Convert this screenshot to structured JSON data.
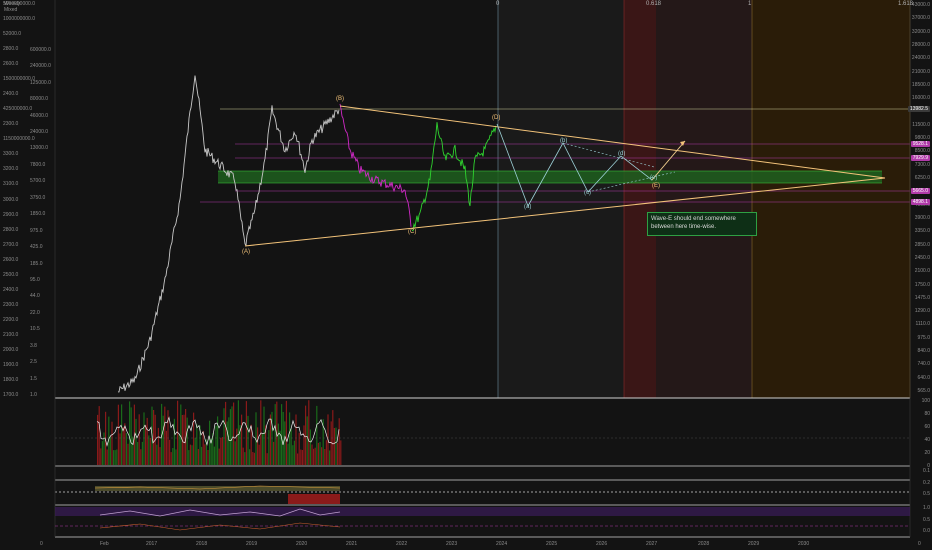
{
  "chart_data": {
    "type": "line",
    "title": "",
    "xlabel": "",
    "ylabel": "",
    "x_ticks": [
      "Feb",
      "2017",
      "2018",
      "2019",
      "2020",
      "2021",
      "2022",
      "2023",
      "2024",
      "2025",
      "2026",
      "2027",
      "2028",
      "2029",
      "2030"
    ],
    "left_axis_ticks": [
      "5000000000.0",
      "1000000000.0",
      "52000.0",
      "2800.0",
      "2600.0",
      "1500000000.0",
      "2400.0",
      "425000000.0",
      "2300.0",
      "1150000000.0",
      "3300.0",
      "3200.0",
      "3100.0",
      "3000.0",
      "2900.0",
      "2800.0",
      "2700.0",
      "2600.0",
      "2500.0",
      "2400.0",
      "2300.0",
      "2200.0",
      "2100.0",
      "2000.0",
      "1900.0",
      "1800.0",
      "1700.0"
    ],
    "left_axis_ticks_short": [
      "Weekly",
      "Mixed",
      "600000.0",
      "240000.0",
      "125000.0",
      "80000.0",
      "46000.0",
      "24000.0",
      "13000.0",
      "7800.0",
      "5700.0",
      "3750.0",
      "1850.0",
      "975.0",
      "425.0",
      "185.0",
      "95.0",
      "44.0",
      "22.0",
      "10.5",
      "3.8",
      "2.5",
      "1.5",
      "1.0"
    ],
    "right_axis_ticks": [
      "43000.0",
      "37000.0",
      "32000.0",
      "28000.0",
      "24000.0",
      "21000.0",
      "18500.0",
      "16000.0",
      "13500.0",
      "11500.0",
      "9800.0",
      "8500.0",
      "7300.0",
      "6250.0",
      "5250.0",
      "4500.0",
      "3900.0",
      "3350.0",
      "2850.0",
      "2450.0",
      "2100.0",
      "1750.0",
      "1475.0",
      "1290.0",
      "1110.0",
      "975.0",
      "840.0",
      "740.0",
      "640.0",
      "565.0"
    ],
    "price_tags": [
      {
        "value": "13982.5",
        "color": "#3a3a3a"
      },
      {
        "value": "9528.1",
        "color": "#b03aa8"
      },
      {
        "value": "7929.9",
        "color": "#b03aa8"
      },
      {
        "value": "5665.0",
        "color": "#b03aa8"
      },
      {
        "value": "4898.1",
        "color": "#b03aa8"
      }
    ],
    "fib_labels": [
      "0",
      "0.618",
      "1",
      "1.618"
    ],
    "wave_labels": [
      "(A)",
      "(B)",
      "(C)",
      "(D)",
      "(E)",
      "(a)",
      "(b)",
      "(c)",
      "(d)",
      "(e)"
    ],
    "oscillator_ticks": [
      "100",
      "80",
      "60",
      "40",
      "20",
      "0"
    ],
    "small_panel_ticks": [
      "0.1",
      "0.2",
      "0.5",
      "1.0",
      "0.5",
      "0.0"
    ],
    "series": [
      {
        "name": "",
        "values": []
      }
    ]
  },
  "annotation": {
    "text_line1": "Wave-E should end somewhere",
    "text_line2": "between here time-wise."
  },
  "corner_labels": {
    "top_left": "Weekly",
    "top_left_2": "Mixed",
    "bottom_left": "0",
    "bottom_right": "0"
  },
  "colors": {
    "background": "#131313",
    "triangle": "#f3c37a",
    "wave_magenta": "#d129c8",
    "wave_green": "#2fd32f",
    "projection": "#9cd0d6",
    "green_zone": "#1f5f1f",
    "orange_zone": "#3a2508",
    "red_zone": "#3a1616"
  }
}
